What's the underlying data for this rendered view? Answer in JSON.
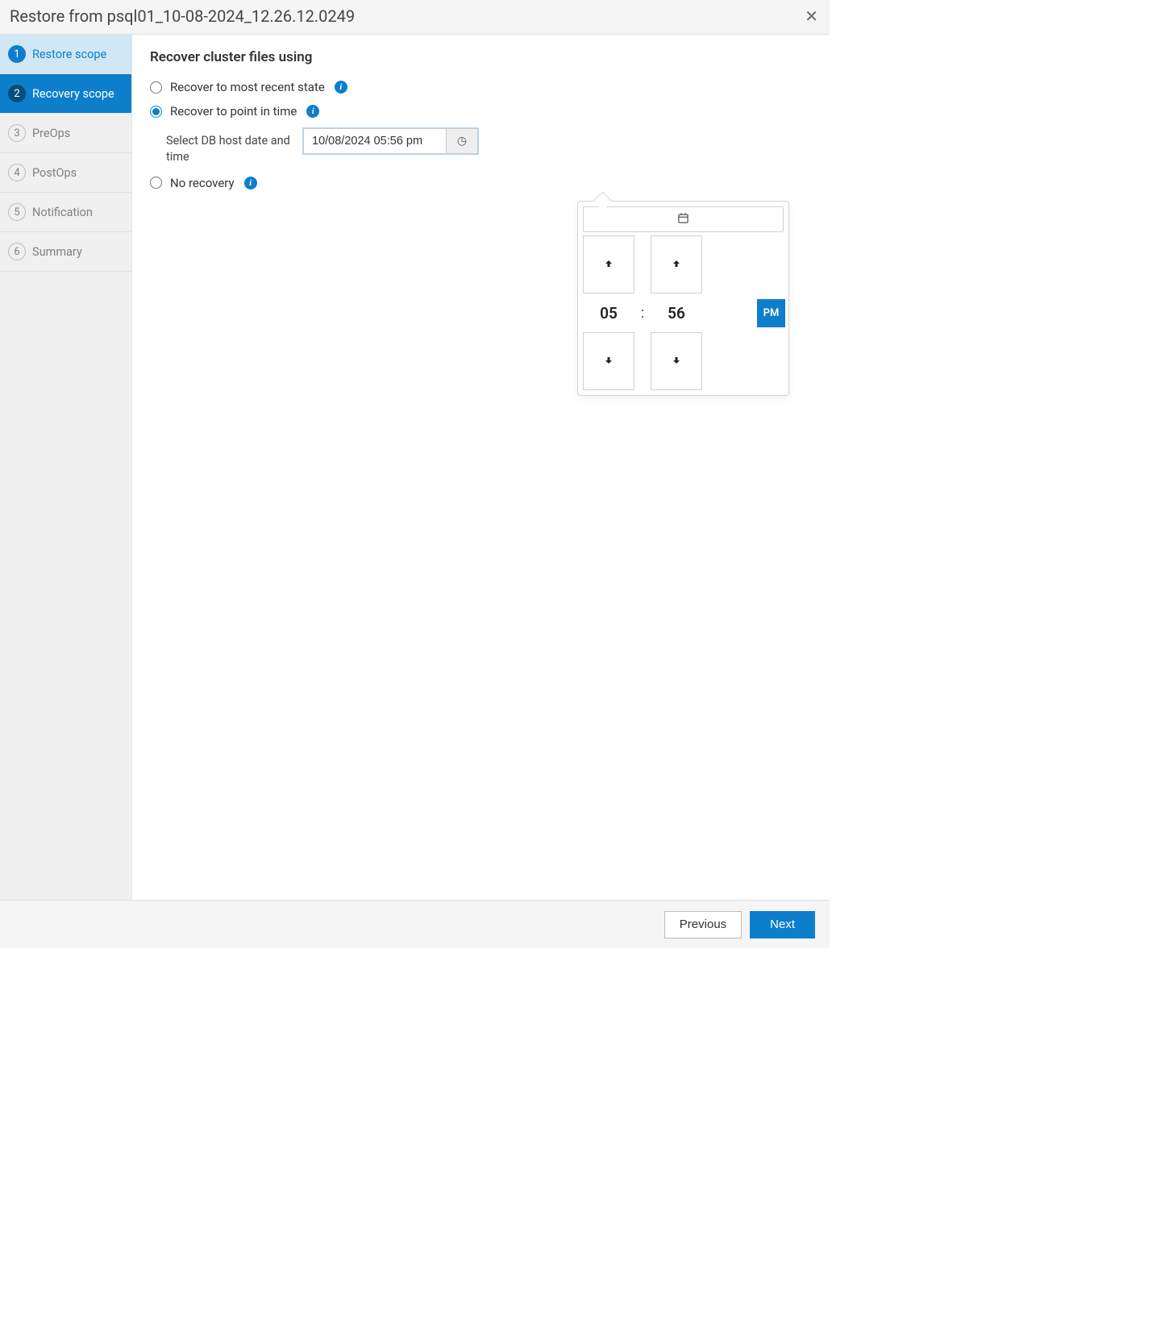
{
  "header": {
    "title": "Restore from psql01_10-08-2024_12.26.12.0249"
  },
  "sidebar": {
    "steps": [
      {
        "num": "1",
        "label": "Restore scope"
      },
      {
        "num": "2",
        "label": "Recovery scope"
      },
      {
        "num": "3",
        "label": "PreOps"
      },
      {
        "num": "4",
        "label": "PostOps"
      },
      {
        "num": "5",
        "label": "Notification"
      },
      {
        "num": "6",
        "label": "Summary"
      }
    ]
  },
  "content": {
    "section_title": "Recover cluster files using",
    "opt_recent": "Recover to most recent state",
    "opt_pit": "Recover to point in time",
    "opt_none": "No recovery",
    "pit_label": "Select DB host date and time",
    "datetime_value": "10/08/2024 05:56 pm"
  },
  "popover": {
    "hour": "05",
    "minute": "56",
    "ampm": "PM"
  },
  "footer": {
    "previous": "Previous",
    "next": "Next"
  },
  "info_glyph": "i",
  "clock_glyph": "◷"
}
